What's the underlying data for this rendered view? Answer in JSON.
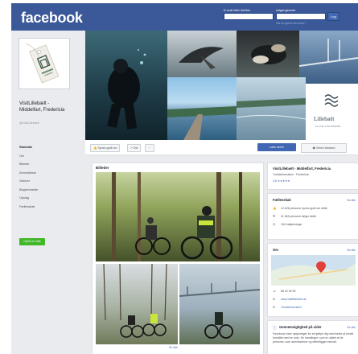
{
  "header": {
    "logo": "facebook",
    "email_label": "E-mail eller telefon",
    "password_label": "Adgangskode",
    "login_button": "Log",
    "forgot": "Har du glemt din konto?"
  },
  "page": {
    "name": "VisitLillebælt - Middelfart, Fredericia",
    "handle": "@VisitLillebaelt",
    "brand_name": "Lillebælt",
    "brand_sub": "VILDE VIDUNDERE"
  },
  "nav": {
    "items": [
      "Startside",
      "Om",
      "Billeder",
      "Anmeldelser",
      "Videoer",
      "Begivenheder",
      "Opslag",
      "Fællesskab"
    ],
    "create_button": "Opret en side"
  },
  "actions": {
    "like": "Synes godt om",
    "share": "Del",
    "more": "···",
    "learn_more": "Læs mere",
    "send": "Send besked"
  },
  "photos": {
    "title": "Billeder",
    "see_all": "Se alle"
  },
  "right": {
    "page_title": "VisitLillebælt - Middelfart, Fredericia",
    "page_sub": "Turistinformation · Fredericia",
    "rating": "4,8",
    "community_title": "Fællesskab",
    "see_all": "Se alle",
    "likes": "12.626 personer synes godt om dette",
    "follows": "11.363 personer følger dette",
    "checkins": "154 indtjekninger",
    "about_title": "Om",
    "phone": "88 32 59 59",
    "website": "www.visitlillebaelt.dk",
    "category": "Turistinformation",
    "transparency_title": "Gennemsigtighed på sider",
    "transparency_text": "Facebook viser oplysninger for at hjælpe dig med bedre at forstå formålet med en side. Se handlinger, som er udført af de personer, som administrerer og offentliggør indhold."
  },
  "colors": {
    "facebook_blue": "#3b5998",
    "button_blue": "#4267b2",
    "green": "#42b72a",
    "background": "#e9ebee"
  }
}
